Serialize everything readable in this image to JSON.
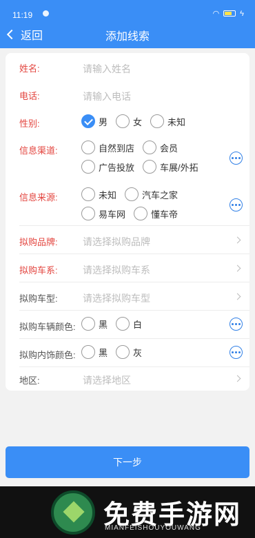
{
  "status": {
    "time": "11:19"
  },
  "header": {
    "back_label": "返回",
    "title": "添加线索"
  },
  "form": {
    "name": {
      "label": "姓名:",
      "placeholder": "请输入姓名"
    },
    "phone": {
      "label": "电话:",
      "placeholder": "请输入电话"
    },
    "gender": {
      "label": "性别:",
      "options": [
        "男",
        "女",
        "未知"
      ],
      "selected": "男"
    },
    "channel": {
      "label": "信息渠道:",
      "options": [
        "自然到店",
        "会员",
        "广告投放",
        "车展/外拓"
      ]
    },
    "source": {
      "label": "信息来源:",
      "options": [
        "未知",
        "汽车之家",
        "易车网",
        "懂车帝"
      ]
    },
    "brand": {
      "label": "拟购品牌:",
      "placeholder": "请选择拟购品牌"
    },
    "series": {
      "label": "拟购车系:",
      "placeholder": "请选择拟购车系"
    },
    "model": {
      "label": "拟购车型:",
      "placeholder": "请选择拟购车型"
    },
    "exterior_color": {
      "label": "拟购车辆颜色:",
      "options": [
        "黑",
        "白"
      ]
    },
    "interior_color": {
      "label": "拟购内饰颜色:",
      "options": [
        "黑",
        "灰"
      ]
    },
    "region": {
      "label": "地区:",
      "placeholder": "请选择地区"
    }
  },
  "footer": {
    "next_label": "下一步"
  },
  "watermark": {
    "title": "免费手游网",
    "subtitle": "MIANFEISHOUYOUWANG"
  },
  "colors": {
    "primary": "#3a8ef6",
    "required_label": "#e3453f"
  }
}
